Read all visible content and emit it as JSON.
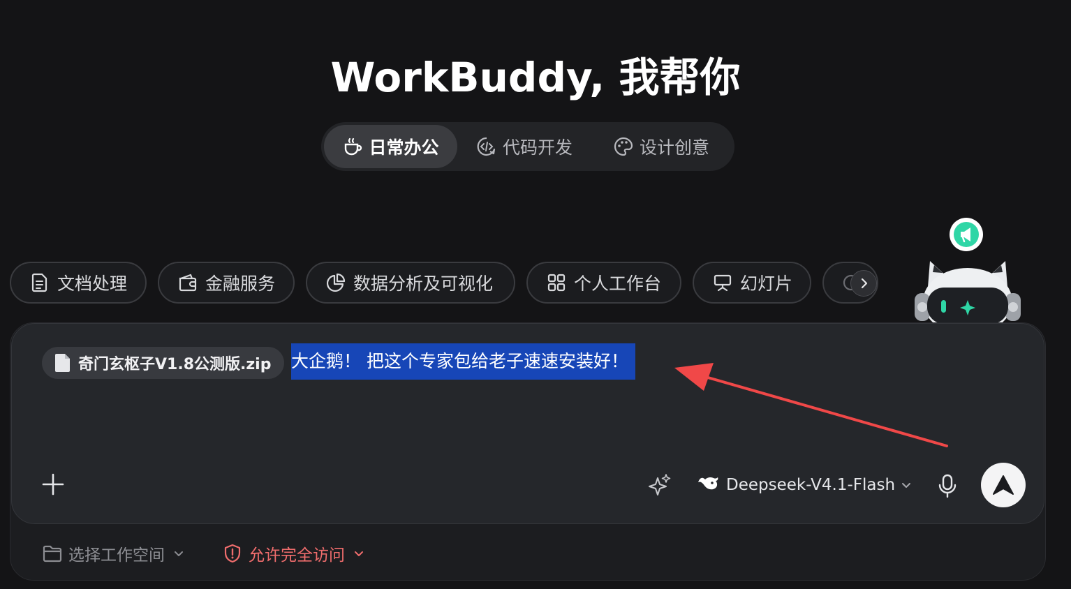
{
  "title": "WorkBuddy, 我帮你",
  "tabs": [
    {
      "label": "日常办公",
      "icon": "coffee-cup-icon",
      "active": true
    },
    {
      "label": "代码开发",
      "icon": "code-icon",
      "active": false
    },
    {
      "label": "设计创意",
      "icon": "palette-icon",
      "active": false
    }
  ],
  "chips": [
    {
      "label": "文档处理",
      "icon": "document-icon"
    },
    {
      "label": "金融服务",
      "icon": "wallet-icon"
    },
    {
      "label": "数据分析及可视化",
      "icon": "pie-chart-icon"
    },
    {
      "label": "个人工作台",
      "icon": "grid-icon"
    },
    {
      "label": "幻灯片",
      "icon": "presentation-icon"
    }
  ],
  "composer": {
    "attachment_name": "奇门玄枢子V1.8公测版.zip",
    "input_text": "大企鹅！ 把这个专家包给老子速速安装好！",
    "model": "Deepseek-V4.1-Flash"
  },
  "footer": {
    "workspace_label": "选择工作空间",
    "access_label": "允许完全访问"
  },
  "colors": {
    "background": "#141416",
    "selection": "#1746b7",
    "arrow": "#f04848",
    "access_warning": "#f06d6d",
    "mascot_accent": "#2fd6a6"
  }
}
